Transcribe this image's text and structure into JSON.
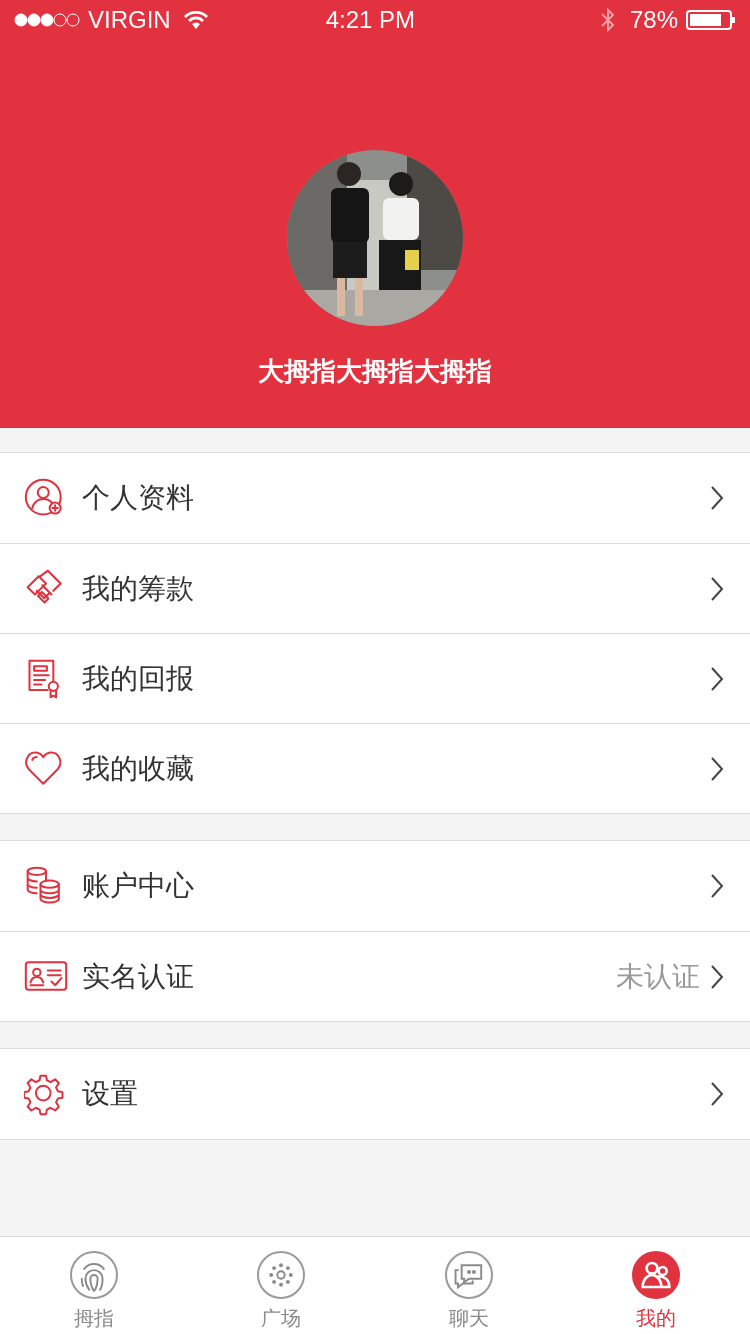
{
  "status_bar": {
    "carrier": "VIRGIN",
    "time": "4:21 PM",
    "battery": "78%"
  },
  "profile": {
    "name": "大拇指大拇指大拇指"
  },
  "menu_groups": [
    {
      "items": [
        {
          "label": "个人资料"
        },
        {
          "label": "我的筹款"
        },
        {
          "label": "我的回报"
        },
        {
          "label": "我的收藏"
        }
      ]
    },
    {
      "items": [
        {
          "label": "账户中心"
        },
        {
          "label": "实名认证",
          "value": "未认证"
        }
      ]
    },
    {
      "items": [
        {
          "label": "设置"
        }
      ]
    }
  ],
  "tab_bar": [
    {
      "label": "拇指",
      "selected": false
    },
    {
      "label": "广场",
      "selected": false
    },
    {
      "label": "聊天",
      "selected": false
    },
    {
      "label": "我的",
      "selected": true
    }
  ]
}
